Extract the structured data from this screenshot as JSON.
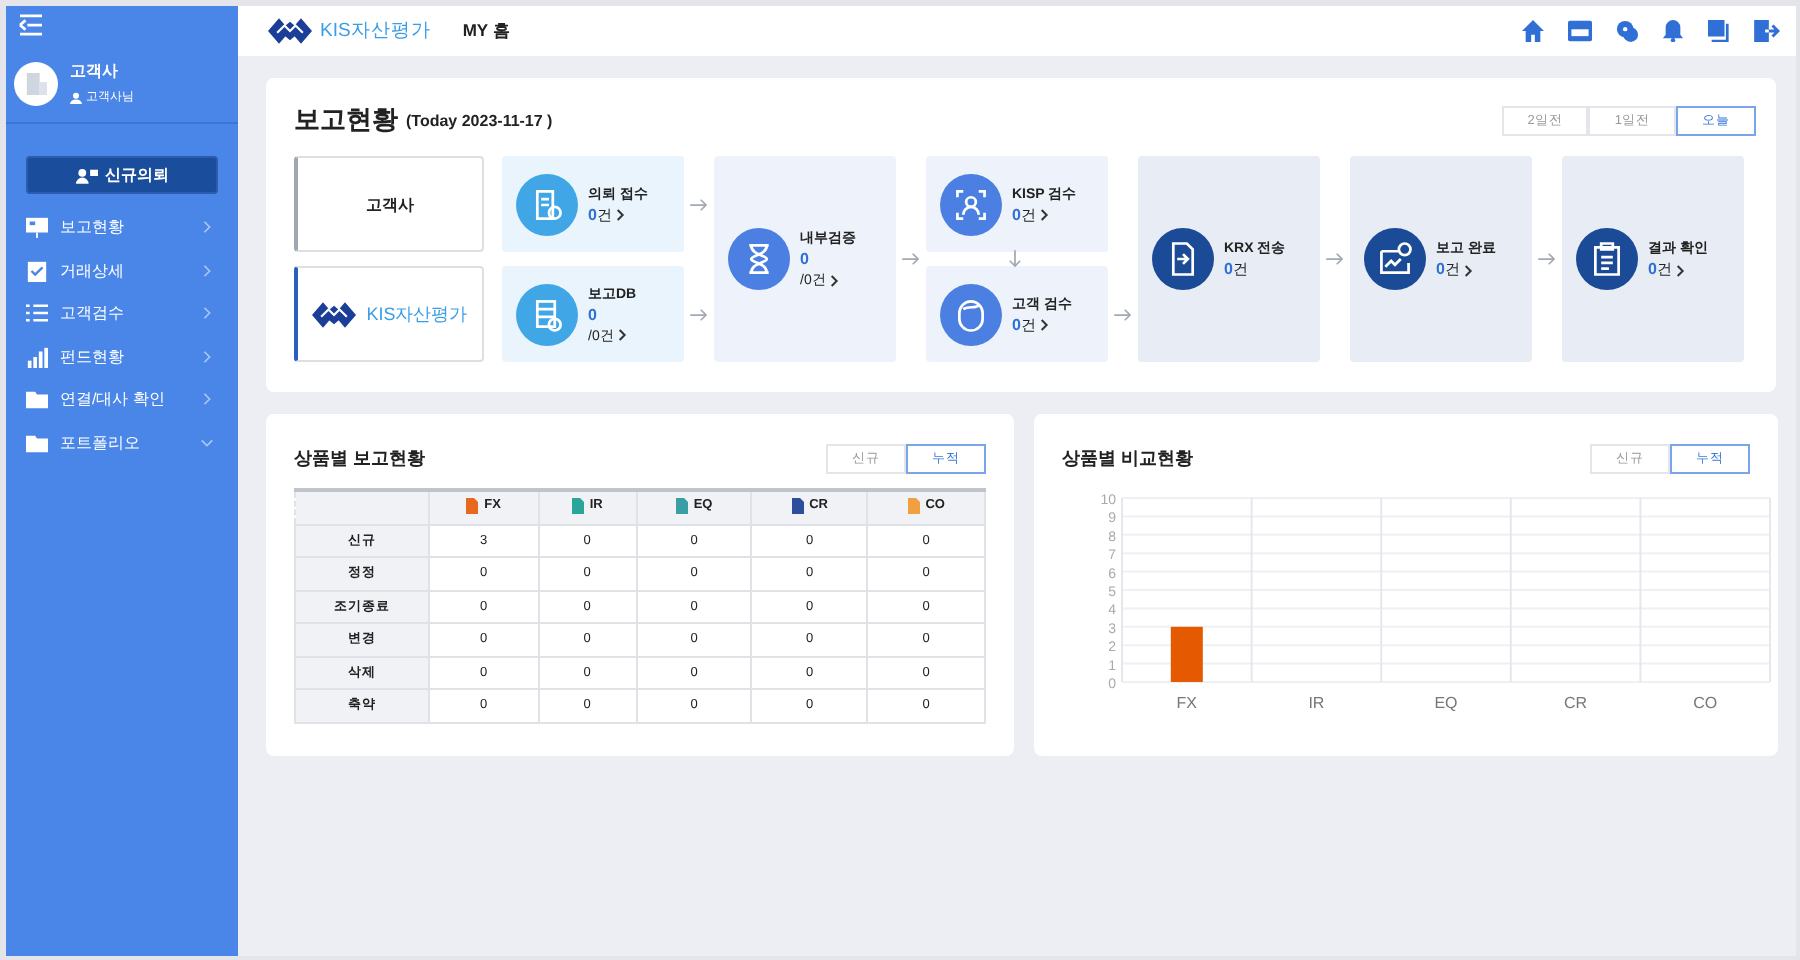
{
  "header": {
    "logo_text": "KIS자산평가",
    "title": "MY 홈"
  },
  "sidebar": {
    "user": {
      "name": "고객사",
      "role": "고객사님"
    },
    "new_request": "신규의뢰",
    "items": [
      {
        "label": "보고현황",
        "has_submenu": false
      },
      {
        "label": "거래상세",
        "has_submenu": false
      },
      {
        "label": "고객검수",
        "has_submenu": false
      },
      {
        "label": "펀드현황",
        "has_submenu": false
      },
      {
        "label": "연결/대사 확인",
        "has_submenu": false
      },
      {
        "label": "포트폴리오",
        "has_submenu": true
      }
    ]
  },
  "report_status": {
    "title": "보고현황",
    "date": "(Today 2023-11-17 )",
    "periods": [
      {
        "label": "2일전",
        "selected": false
      },
      {
        "label": "1일전",
        "selected": false
      },
      {
        "label": "오늘",
        "selected": true
      }
    ],
    "companies": [
      {
        "kind": "text",
        "label": "고객사",
        "selected": false
      },
      {
        "kind": "logo",
        "label": "KIS자산평가",
        "selected": true
      }
    ],
    "stages": [
      {
        "cards": [
          {
            "title": "의뢰 접수",
            "value": "0",
            "unit": "건",
            "chevron": true
          },
          {
            "title": "보고DB",
            "value": "0",
            "sub": "/0건",
            "chevron": true
          }
        ]
      },
      {
        "cards": [
          {
            "title": "내부검증",
            "value": "0",
            "sub": "/0건",
            "chevron": true
          }
        ]
      },
      {
        "cards": [
          {
            "title": "KISP 검수",
            "value": "0",
            "unit": "건",
            "chevron": true
          },
          {
            "title": "고객 검수",
            "value": "0",
            "unit": "건",
            "chevron": true
          }
        ]
      },
      {
        "cards": [
          {
            "title": "KRX 전송",
            "value": "0",
            "unit": "건",
            "chevron": false
          }
        ]
      },
      {
        "cards": [
          {
            "title": "보고 완료",
            "value": "0",
            "unit": "건",
            "chevron": true
          }
        ]
      },
      {
        "cards": [
          {
            "title": "결과 확인",
            "value": "0",
            "unit": "건",
            "chevron": true
          }
        ]
      }
    ]
  },
  "product_table": {
    "title": "상품별 보고현황",
    "toggles": [
      {
        "label": "신규",
        "selected": false
      },
      {
        "label": "누적",
        "selected": true
      }
    ],
    "columns": [
      {
        "label": "FX",
        "color": "#e8691e"
      },
      {
        "label": "IR",
        "color": "#2aa59a"
      },
      {
        "label": "EQ",
        "color": "#3a9fa5"
      },
      {
        "label": "CR",
        "color": "#2c4e9c"
      },
      {
        "label": "CO",
        "color": "#f0a040"
      }
    ],
    "rows": [
      {
        "label": "신규",
        "cells": [
          "3",
          "0",
          "0",
          "0",
          "0"
        ]
      },
      {
        "label": "정정",
        "cells": [
          "0",
          "0",
          "0",
          "0",
          "0"
        ]
      },
      {
        "label": "조기종료",
        "cells": [
          "0",
          "0",
          "0",
          "0",
          "0"
        ]
      },
      {
        "label": "변경",
        "cells": [
          "0",
          "0",
          "0",
          "0",
          "0"
        ]
      },
      {
        "label": "삭제",
        "cells": [
          "0",
          "0",
          "0",
          "0",
          "0"
        ]
      },
      {
        "label": "축약",
        "cells": [
          "0",
          "0",
          "0",
          "0",
          "0"
        ]
      }
    ]
  },
  "product_chart": {
    "title": "상품별 비교현황",
    "toggles": [
      {
        "label": "신규",
        "selected": false
      },
      {
        "label": "누적",
        "selected": true
      }
    ],
    "chart_data": {
      "type": "bar",
      "categories": [
        "FX",
        "IR",
        "EQ",
        "CR",
        "CO"
      ],
      "series": [
        {
          "color": "#e55a00",
          "values": [
            3,
            0,
            0,
            0,
            0
          ]
        }
      ],
      "ylim": [
        0,
        10
      ],
      "yticks": [
        0,
        1,
        2,
        3,
        4,
        5,
        6,
        7,
        8,
        9,
        10
      ],
      "grid": true
    }
  }
}
